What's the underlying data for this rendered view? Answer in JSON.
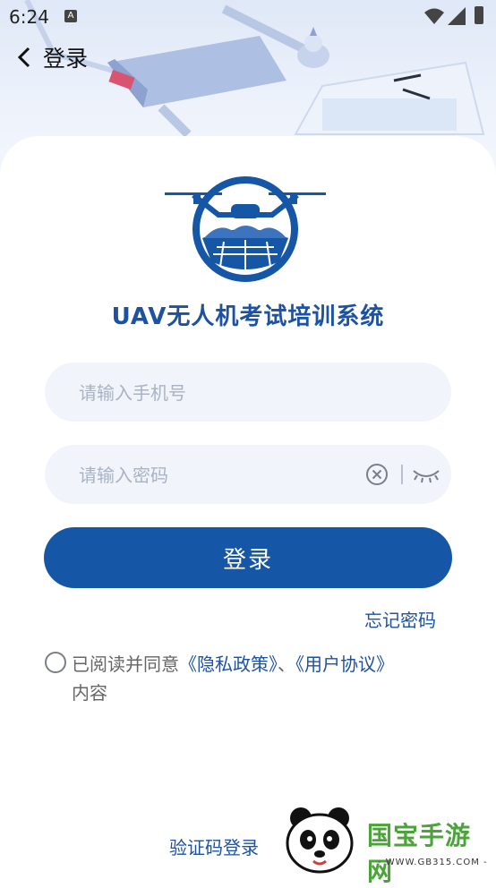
{
  "status_bar": {
    "time": "6:24",
    "notification_icon": "A"
  },
  "nav": {
    "title": "登录"
  },
  "app": {
    "title": "UAV无人机考试培训系统"
  },
  "form": {
    "phone_placeholder": "请输入手机号",
    "password_placeholder": "请输入密码",
    "login_label": "登录",
    "forgot_label": "忘记密码"
  },
  "agreement": {
    "prefix": "已阅读并同意",
    "privacy_link": "《隐私政策》",
    "separator": "、",
    "terms_link": "《用户协议》",
    "suffix": "内容"
  },
  "footer": {
    "sms_login_label": "验证码登录"
  },
  "watermark": {
    "name": "国宝手游网",
    "url": "- WWW.GB315.COM -"
  },
  "colors": {
    "primary": "#1557a6",
    "link": "#1d52a3",
    "field_bg": "#f1f4fa"
  }
}
